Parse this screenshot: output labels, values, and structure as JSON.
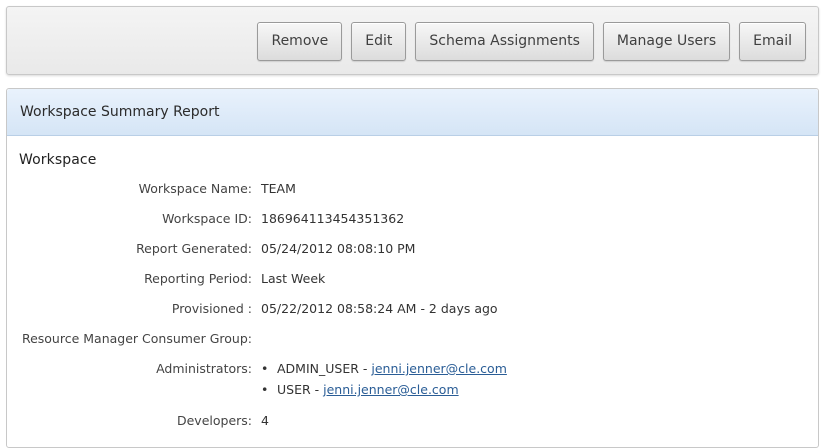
{
  "toolbar": {
    "buttons": [
      "Remove",
      "Edit",
      "Schema Assignments",
      "Manage Users",
      "Email"
    ]
  },
  "region": {
    "title": "Workspace Summary Report",
    "section_title": "Workspace",
    "fields": {
      "workspace_name": {
        "label": "Workspace Name:",
        "value": "TEAM"
      },
      "workspace_id": {
        "label": "Workspace ID:",
        "value": "186964113454351362"
      },
      "report_generated": {
        "label": "Report Generated:",
        "value": "05/24/2012 08:08:10 PM"
      },
      "reporting_period": {
        "label": "Reporting Period:",
        "value": "Last Week"
      },
      "provisioned": {
        "label": "Provisioned :",
        "value": "05/22/2012 08:58:24 AM - 2 days ago"
      },
      "consumer_group": {
        "label": "Resource Manager Consumer Group:",
        "value": ""
      },
      "administrators": {
        "label": "Administrators:",
        "items": [
          {
            "bullet": "•",
            "name": "ADMIN_USER - ",
            "email": "jenni.jenner@cle.com"
          },
          {
            "bullet": "•",
            "name": "USER - ",
            "email": "jenni.jenner@cle.com"
          }
        ]
      },
      "developers": {
        "label": "Developers:",
        "value": "4"
      }
    }
  }
}
